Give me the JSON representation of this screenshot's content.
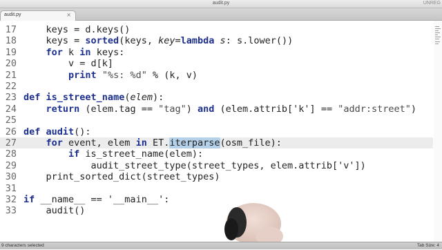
{
  "window": {
    "title": "audit.py",
    "unregistered": "UNREG"
  },
  "tab": {
    "label": "audit.py",
    "close": "×"
  },
  "editor": {
    "current_line": "27",
    "lines": [
      {
        "n": "17",
        "parts": [
          [
            "    keys = d.keys()",
            ""
          ]
        ]
      },
      {
        "n": "18",
        "parts": [
          [
            "    keys = ",
            ""
          ],
          [
            "sorted",
            "fn"
          ],
          [
            "(keys, ",
            ""
          ],
          [
            "key",
            "it"
          ],
          [
            "=",
            ""
          ],
          [
            "lambda",
            "kw"
          ],
          [
            " ",
            ""
          ],
          [
            "s",
            "it"
          ],
          [
            ": s.lower())",
            ""
          ]
        ]
      },
      {
        "n": "19",
        "parts": [
          [
            "    ",
            ""
          ],
          [
            "for",
            "kw"
          ],
          [
            " k ",
            ""
          ],
          [
            "in",
            "kw"
          ],
          [
            " keys:",
            ""
          ]
        ]
      },
      {
        "n": "20",
        "parts": [
          [
            "        v = d[k]",
            ""
          ]
        ]
      },
      {
        "n": "21",
        "parts": [
          [
            "        ",
            ""
          ],
          [
            "print",
            "kw"
          ],
          [
            " ",
            ""
          ],
          [
            "\"%s: %d\"",
            "str"
          ],
          [
            " % (k, v)",
            ""
          ]
        ]
      },
      {
        "n": "22",
        "parts": []
      },
      {
        "n": "23",
        "parts": [
          [
            "def",
            "kw"
          ],
          [
            " ",
            ""
          ],
          [
            "is_street_name",
            "fn"
          ],
          [
            "(",
            ""
          ],
          [
            "elem",
            "it"
          ],
          [
            "):",
            ""
          ]
        ]
      },
      {
        "n": "24",
        "parts": [
          [
            "    ",
            ""
          ],
          [
            "return",
            "kw"
          ],
          [
            " (elem.tag == ",
            ""
          ],
          [
            "\"tag\"",
            "str"
          ],
          [
            ") ",
            ""
          ],
          [
            "and",
            "kw"
          ],
          [
            " (elem.attrib['k'] == ",
            ""
          ],
          [
            "\"addr:street\"",
            "str"
          ],
          [
            ")",
            ""
          ]
        ]
      },
      {
        "n": "25",
        "parts": []
      },
      {
        "n": "26",
        "parts": [
          [
            "def",
            "kw"
          ],
          [
            " ",
            ""
          ],
          [
            "audit",
            "fn"
          ],
          [
            "():",
            ""
          ]
        ]
      },
      {
        "n": "27",
        "parts": [
          [
            "    ",
            ""
          ],
          [
            "for",
            "kw"
          ],
          [
            " event, elem ",
            ""
          ],
          [
            "in",
            "kw"
          ],
          [
            " ET.",
            ""
          ],
          [
            "iterparse",
            "sel"
          ],
          [
            "(osm_file):",
            ""
          ]
        ]
      },
      {
        "n": "28",
        "parts": [
          [
            "        ",
            ""
          ],
          [
            "if",
            "kw"
          ],
          [
            " is_street_name(elem):",
            ""
          ]
        ]
      },
      {
        "n": "29",
        "parts": [
          [
            "            audit_street_type(street_types, elem.attrib['v'])",
            ""
          ]
        ]
      },
      {
        "n": "30",
        "parts": [
          [
            "    print_sorted_dict(street_types)",
            ""
          ]
        ]
      },
      {
        "n": "31",
        "parts": []
      },
      {
        "n": "32",
        "parts": [
          [
            "if",
            "kw"
          ],
          [
            " __name__ == '__main__':",
            ""
          ]
        ]
      },
      {
        "n": "33",
        "parts": [
          [
            "    audit()",
            ""
          ]
        ]
      }
    ]
  },
  "status": {
    "selection": "9 characters selected",
    "tab_size": "Tab Size: 4"
  }
}
